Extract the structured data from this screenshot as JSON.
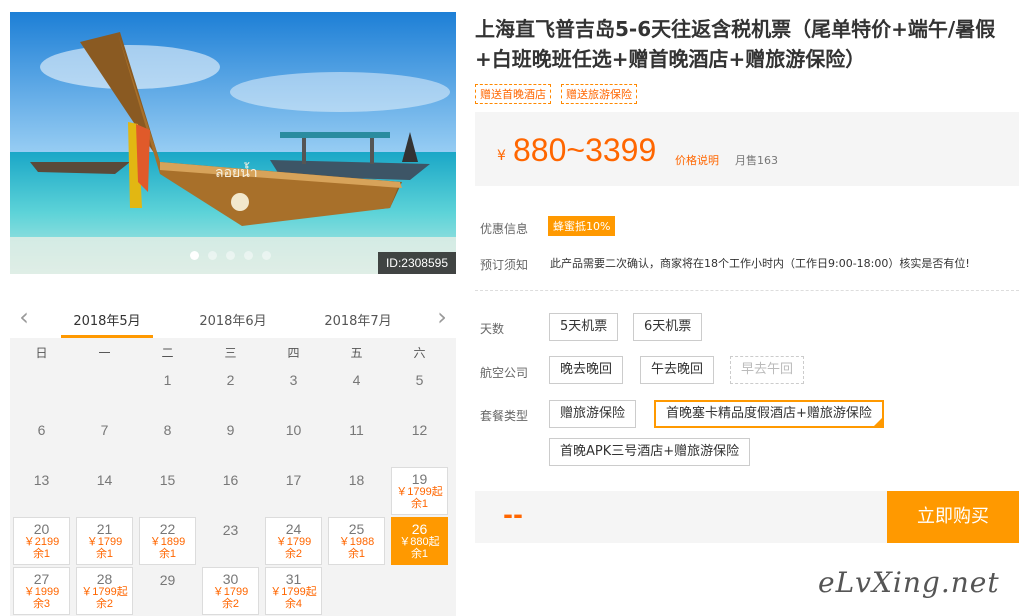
{
  "product": {
    "title": "上海直飞普吉岛5-6天往返含税机票（尾单特价+端午/暑假+白班晚班任选+赠首晚酒店+赠旅游保险）",
    "tags": [
      "赠送首晚酒店",
      "赠送旅游保险"
    ],
    "image_id": "ID:2308595",
    "price": {
      "currency": "¥",
      "range": "880~3399",
      "explain_label": "价格说明",
      "monthly_sold": "月售163"
    }
  },
  "info": {
    "promo_label": "优惠信息",
    "promo_badge": "蜂蜜抵10%",
    "notice_label": "预订须知",
    "notice_text": "此产品需要二次确认，商家将在18个工作小时内（工作日9:00-18:00）核实是否有位!"
  },
  "options": {
    "days": {
      "label": "天数",
      "items": [
        "5天机票",
        "6天机票"
      ]
    },
    "airline": {
      "label": "航空公司",
      "items": [
        "晚去晚回",
        "午去晚回",
        "早去午回"
      ]
    },
    "package": {
      "label": "套餐类型",
      "items": [
        "赠旅游保险",
        "首晚塞卡精品度假酒店+赠旅游保险",
        "首晚APK三号酒店+赠旅游保险"
      ]
    }
  },
  "purchase": {
    "price_placeholder": "--",
    "buy_label": "立即购买"
  },
  "calendar": {
    "months": [
      "2018年5月",
      "2018年6月",
      "2018年7月"
    ],
    "active_month_index": 0,
    "weekdays": [
      "日",
      "一",
      "二",
      "三",
      "四",
      "五",
      "六"
    ],
    "prev_icon": "chevron-left-icon",
    "next_icon": "chevron-right-icon",
    "days": [
      {
        "d": "",
        "p": "",
        "r": ""
      },
      {
        "d": "",
        "p": "",
        "r": ""
      },
      {
        "d": "1",
        "p": "",
        "r": ""
      },
      {
        "d": "2",
        "p": "",
        "r": ""
      },
      {
        "d": "3",
        "p": "",
        "r": ""
      },
      {
        "d": "4",
        "p": "",
        "r": ""
      },
      {
        "d": "5",
        "p": "",
        "r": ""
      },
      {
        "d": "6",
        "p": "",
        "r": ""
      },
      {
        "d": "7",
        "p": "",
        "r": ""
      },
      {
        "d": "8",
        "p": "",
        "r": ""
      },
      {
        "d": "9",
        "p": "",
        "r": ""
      },
      {
        "d": "10",
        "p": "",
        "r": ""
      },
      {
        "d": "11",
        "p": "",
        "r": ""
      },
      {
        "d": "12",
        "p": "",
        "r": ""
      },
      {
        "d": "13",
        "p": "",
        "r": ""
      },
      {
        "d": "14",
        "p": "",
        "r": ""
      },
      {
        "d": "15",
        "p": "",
        "r": ""
      },
      {
        "d": "16",
        "p": "",
        "r": ""
      },
      {
        "d": "17",
        "p": "",
        "r": ""
      },
      {
        "d": "18",
        "p": "",
        "r": ""
      },
      {
        "d": "19",
        "p": "￥1799起",
        "r": "余1"
      },
      {
        "d": "20",
        "p": "￥2199",
        "r": "余1"
      },
      {
        "d": "21",
        "p": "￥1799",
        "r": "余1"
      },
      {
        "d": "22",
        "p": "￥1899",
        "r": "余1"
      },
      {
        "d": "23",
        "p": "",
        "r": ""
      },
      {
        "d": "24",
        "p": "￥1799",
        "r": "余2"
      },
      {
        "d": "25",
        "p": "￥1988",
        "r": "余1"
      },
      {
        "d": "26",
        "p": "￥880起",
        "r": "余1",
        "selected": true
      },
      {
        "d": "27",
        "p": "￥1999",
        "r": "余3"
      },
      {
        "d": "28",
        "p": "￥1799起",
        "r": "余2"
      },
      {
        "d": "29",
        "p": "",
        "r": ""
      },
      {
        "d": "30",
        "p": "￥1799",
        "r": "余2"
      },
      {
        "d": "31",
        "p": "￥1799起",
        "r": "余4"
      }
    ]
  },
  "watermark": "eLvXing.net",
  "colors": {
    "accent": "#ff9900",
    "price": "#ff6600"
  }
}
